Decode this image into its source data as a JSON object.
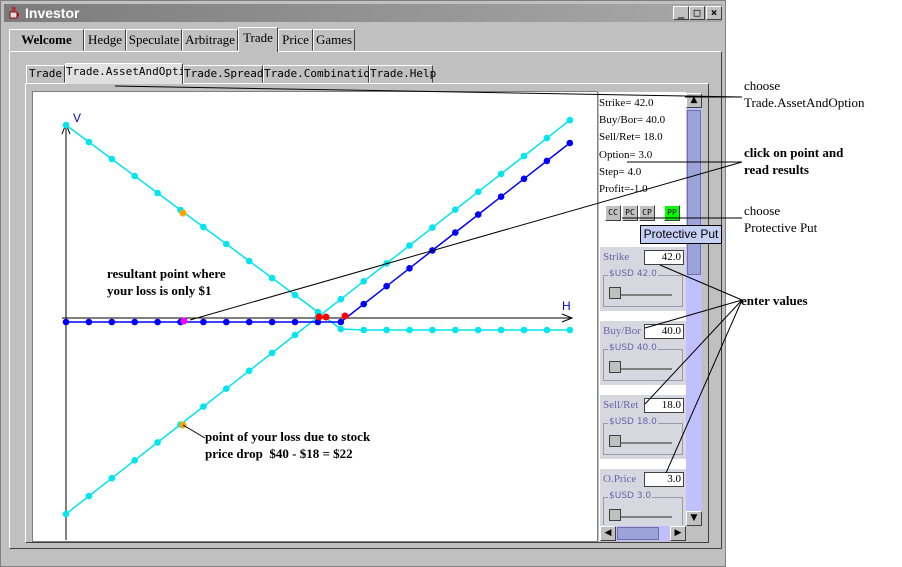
{
  "window": {
    "title": "Investor"
  },
  "main_tabs": [
    {
      "label": "Welcome",
      "bold": true
    },
    {
      "label": "Hedge"
    },
    {
      "label": "Speculate"
    },
    {
      "label": "Arbitrage"
    },
    {
      "label": "Trade",
      "active": true
    },
    {
      "label": "Price"
    },
    {
      "label": "Games"
    }
  ],
  "sub_tabs": [
    {
      "label": "Trade"
    },
    {
      "label": "Trade.AssetAndOption",
      "active": true
    },
    {
      "label": "Trade.Spreads"
    },
    {
      "label": "Trade.Combinations"
    },
    {
      "label": "Trade.Help"
    }
  ],
  "results": {
    "strike": "Strike= 42.0",
    "buy": "Buy/Bor= 40.0",
    "sell": "Sell/Ret= 18.0",
    "option": "Option= 3.0",
    "step": "Step= 4.0",
    "profit": "Profit=-1.0"
  },
  "strategy_buttons": [
    {
      "label": "CC"
    },
    {
      "label": "PC"
    },
    {
      "label": "CP"
    },
    {
      "label": "PP",
      "active": true
    }
  ],
  "tooltip": "Protective Put",
  "controls": [
    {
      "label": "Strike",
      "value": "42.0",
      "slider_caption": "$USD 42.0"
    },
    {
      "label": "Buy/Bor",
      "value": "40.0",
      "slider_caption": "$USD 40.0"
    },
    {
      "label": "Sell/Ret",
      "value": "18.0",
      "slider_caption": "$USD 18.0"
    },
    {
      "label": "O.Price",
      "value": "3.0",
      "slider_caption": "$USD 3.0"
    }
  ],
  "plot": {
    "y_axis_label": "V",
    "x_axis_label": "H",
    "colors": {
      "cyan": "#00e5ee",
      "blue": "#0000ff",
      "red": "#ff0000",
      "orange": "#ffa500",
      "magenta": "#ff00ff"
    }
  },
  "annotations": {
    "choose_tab": "choose\nTrade.AssetAndOption",
    "click_point": "click on point and\nread results",
    "choose_pp": "choose\nProtective Put",
    "enter_values": "enter values",
    "resultant": "resultant point where\nyour loss is only $1",
    "loss_point": "point of your loss due to stock\nprice drop  $40 - $18 = $22"
  },
  "icons": {
    "app": "java-cup-icon",
    "minimize": "minimize-icon",
    "maximize": "maximize-icon",
    "close": "close-icon"
  }
}
